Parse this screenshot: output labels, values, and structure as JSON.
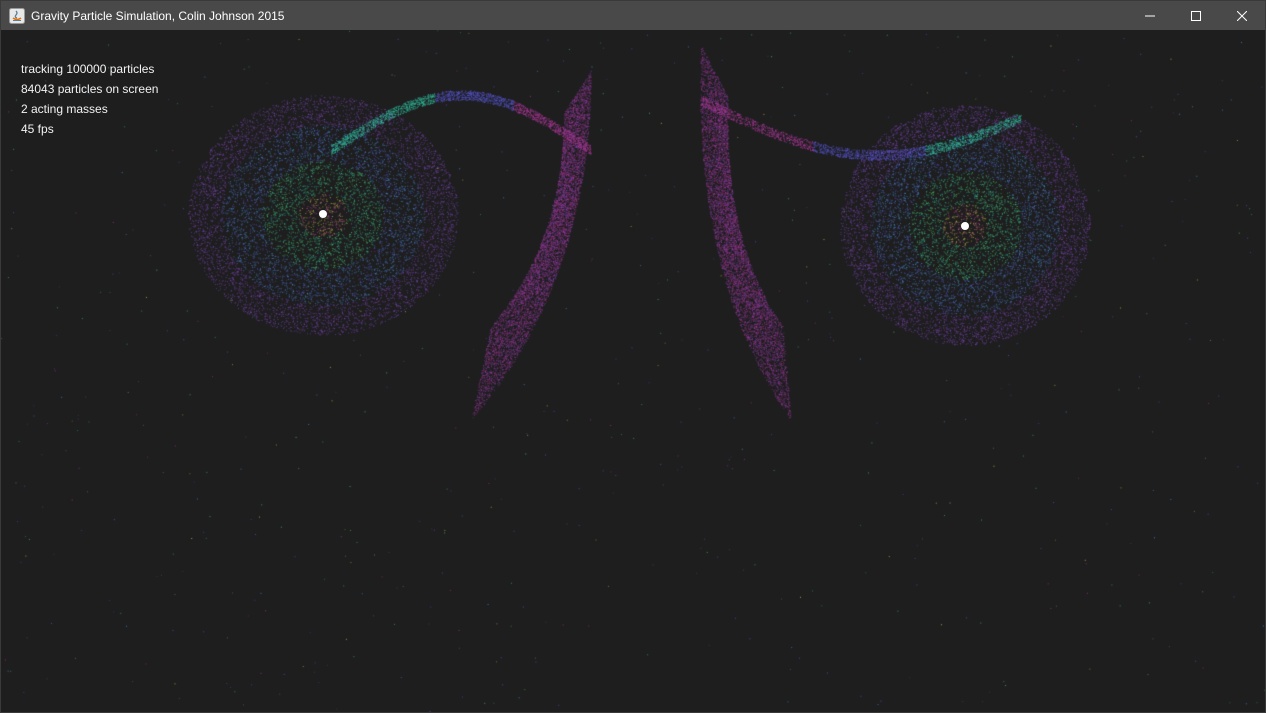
{
  "window": {
    "title": "Gravity Particle Simulation, Colin Johnson 2015",
    "controls": {
      "minimize": "minimize-icon",
      "maximize": "maximize-icon",
      "close": "close-icon"
    }
  },
  "hud": {
    "line1": "tracking 100000 particles",
    "line2": "84043 particles on screen",
    "line3": "2 acting masses",
    "line4": "45 fps"
  },
  "masses": [
    {
      "name": "mass-left"
    },
    {
      "name": "mass-right"
    }
  ],
  "colors": {
    "background": "#1e1e1f",
    "titlebar": "#494949",
    "particle_outer": "#b03a9c",
    "particle_mid": "#5b59d6",
    "particle_inner": "#33c9a8",
    "particle_core": "#d9d64a"
  }
}
